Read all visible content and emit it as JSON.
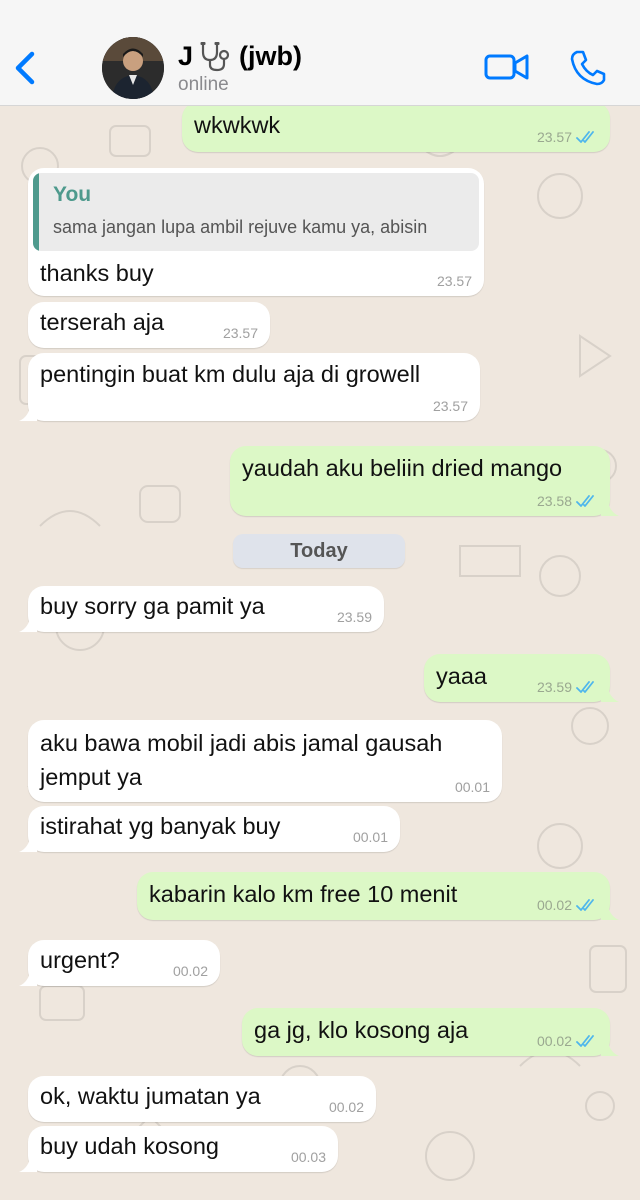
{
  "header": {
    "back_label": "",
    "contact_name": "J",
    "contact_suffix": "(jwb)",
    "status": "online"
  },
  "date_divider": "Today",
  "messages": [
    {
      "dir": "out",
      "text": "wkwkwk",
      "time": "23.57",
      "read": true
    },
    {
      "dir": "in",
      "quote_author": "You",
      "quote_text": "sama jangan lupa ambil rejuve kamu ya, abisin",
      "text": "thanks buy",
      "time": "23.57"
    },
    {
      "dir": "in",
      "text": "terserah aja",
      "time": "23.57"
    },
    {
      "dir": "in",
      "text": "pentingin buat km dulu aja di growell",
      "time": "23.57"
    },
    {
      "dir": "out",
      "text": "yaudah aku beliin dried mango",
      "time": "23.58",
      "read": true
    },
    {
      "dir": "in",
      "text": "buy sorry ga pamit ya",
      "time": "23.59"
    },
    {
      "dir": "out",
      "text": "yaaa",
      "time": "23.59",
      "read": true
    },
    {
      "dir": "in",
      "text": "aku bawa mobil jadi abis jamal gausah",
      "text2": "jemput ya",
      "time": "00.01"
    },
    {
      "dir": "in",
      "text": "istirahat yg banyak buy",
      "time": "00.01"
    },
    {
      "dir": "out",
      "text": "kabarin kalo km free 10 menit",
      "time": "00.02",
      "read": true
    },
    {
      "dir": "in",
      "text": "urgent?",
      "time": "00.02"
    },
    {
      "dir": "out",
      "text": "ga jg, klo kosong aja",
      "time": "00.02",
      "read": true
    },
    {
      "dir": "in",
      "text": "ok, waktu jumatan ya",
      "time": "00.02"
    },
    {
      "dir": "in",
      "text": "buy udah kosong",
      "time": "00.03"
    }
  ],
  "colors": {
    "accent": "#007aff",
    "outgoing_bubble": "#dcf8c6",
    "incoming_bubble": "#ffffff",
    "read_ticks": "#4fb6ec",
    "quote_accent": "#4e9a8d"
  },
  "icons": [
    "chevron-left-icon",
    "stethoscope-icon",
    "video-call-icon",
    "phone-icon",
    "double-check-icon"
  ]
}
